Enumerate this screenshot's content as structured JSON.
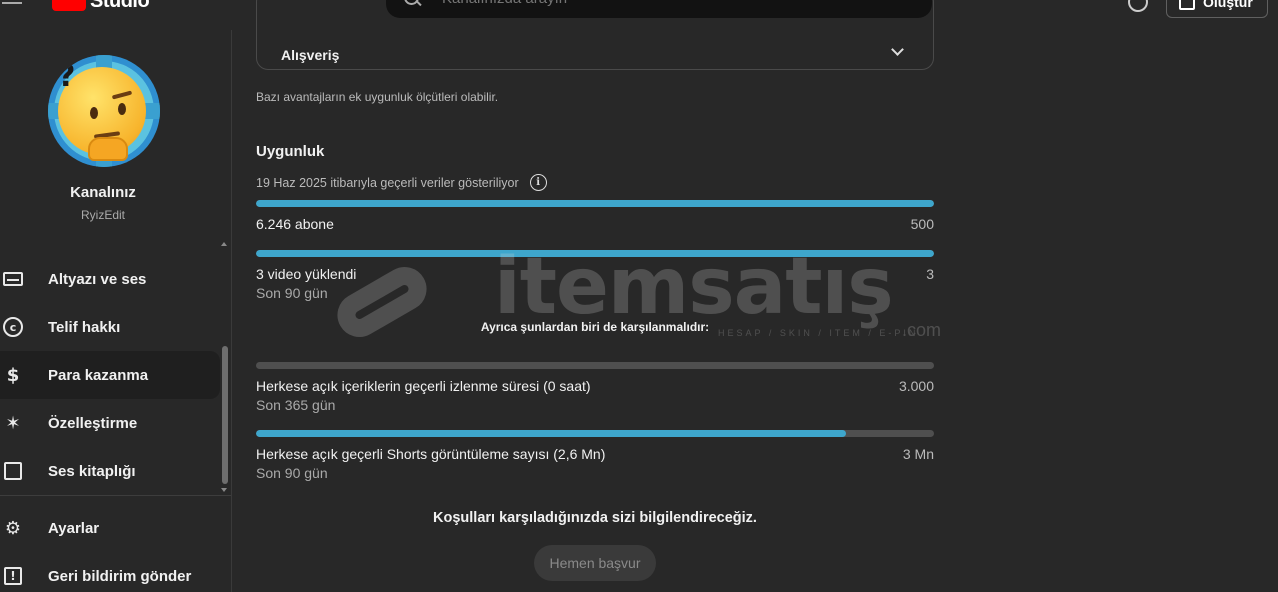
{
  "header": {
    "logo_text": "Studio",
    "search_placeholder": "Kanalınızda arayın",
    "create_label": "Oluştur"
  },
  "sidebar": {
    "channel_name": "Kanalınız",
    "channel_handle": "RyizEdit",
    "items": [
      {
        "label": "Altyazı ve ses",
        "icon": "subtitles-icon"
      },
      {
        "label": "Telif hakkı",
        "icon": "copyright-icon"
      },
      {
        "label": "Para kazanma",
        "icon": "dollar-icon",
        "active": true
      },
      {
        "label": "Özelleştirme",
        "icon": "magic-wand-icon"
      },
      {
        "label": "Ses kitaplığı",
        "icon": "audio-library-icon"
      }
    ],
    "bottom_items": [
      {
        "label": "Ayarlar",
        "icon": "gear-icon"
      },
      {
        "label": "Geri bildirim gönder",
        "icon": "feedback-icon"
      }
    ]
  },
  "main": {
    "accordion_title": "Alışveriş",
    "note": "Bazı avantajların ek uygunluk ölçütleri olabilir.",
    "section_title": "Uygunluk",
    "date_line": "19 Haz 2025 itibarıyla geçerli veriler gösteriliyor",
    "requirements": [
      {
        "label": "6.246 abone",
        "sub": "",
        "target": "500",
        "progress": 1.0
      },
      {
        "label": "3 video yüklendi",
        "sub": "Son 90 gün",
        "target": "3",
        "progress": 1.0
      }
    ],
    "also_text": "Ayrıca şunlardan biri de karşılanmalıdır:",
    "alt_requirements": [
      {
        "label": "Herkese açık içeriklerin geçerli izlenme süresi (0 saat)",
        "sub": "Son 365 gün",
        "target": "3.000",
        "progress": 0.0
      },
      {
        "label": "Herkese açık geçerli Shorts görüntüleme sayısı (2,6 Mn)",
        "sub": "Son 90 gün",
        "target": "3 Mn",
        "progress": 0.87
      }
    ],
    "notify_text": "Koşulları karşıladığınızda sizi bilgilendireceğiz.",
    "apply_label": "Hemen başvur"
  },
  "watermark": {
    "text": "itemsatış",
    "sub": "HESAP / SKIN / ITEM / E-PIN",
    "com": ".com"
  },
  "colors": {
    "accent": "#3ea6cc",
    "bar_bg": "#4f4f4f",
    "page_bg": "#282828"
  }
}
